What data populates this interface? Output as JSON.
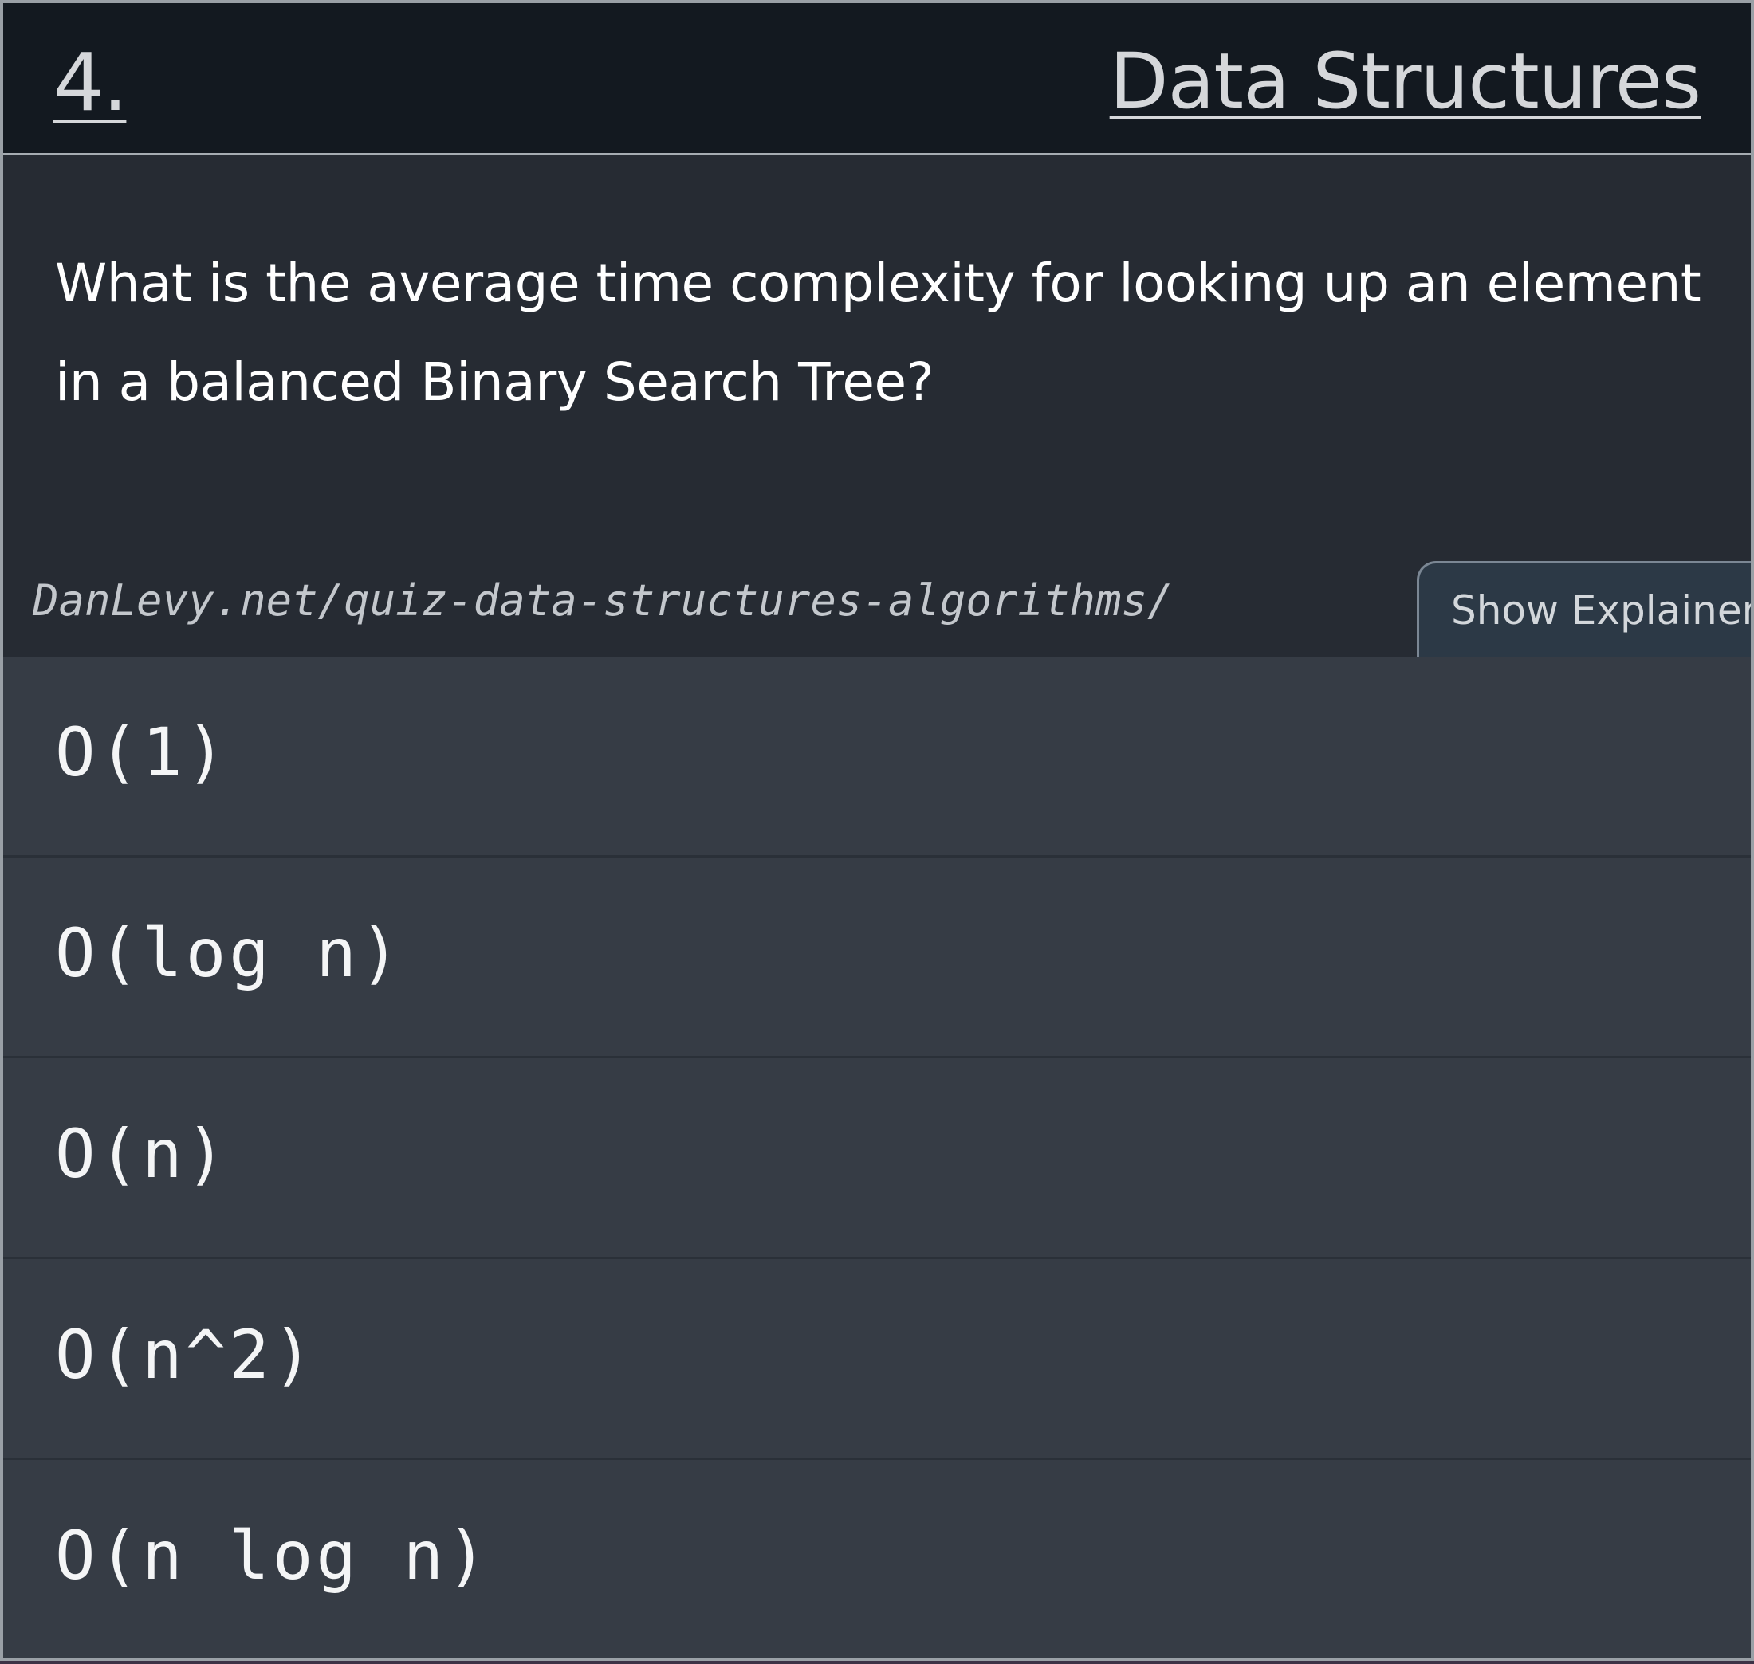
{
  "header": {
    "question_number": "4.",
    "category": "Data Structures"
  },
  "question": {
    "text": "What is the average time complexity for looking up an element in a balanced Binary Search Tree?"
  },
  "source": {
    "url_text": "DanLevy.net/quiz-data-structures-algorithms/"
  },
  "explainer_button": {
    "label": "Show Explainer"
  },
  "options": [
    {
      "label": "O(1)"
    },
    {
      "label": "O(log n)"
    },
    {
      "label": "O(n)"
    },
    {
      "label": "O(n^2)"
    },
    {
      "label": "O(n log n)"
    }
  ],
  "colors": {
    "header_bg": "#131920",
    "card_bg": "#262b33",
    "option_bg": "#363c45",
    "button_bg": "#2c3946",
    "text": "#ffffff"
  }
}
